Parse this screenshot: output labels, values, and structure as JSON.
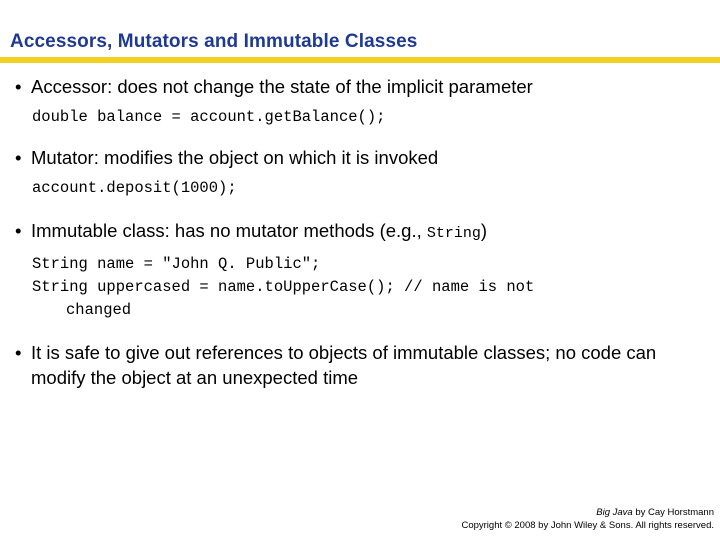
{
  "slide": {
    "title": "Accessors, Mutators and Immutable Classes",
    "accent_color": "#F2D022",
    "title_color": "#1F3A93",
    "bullet_marker": "•"
  },
  "content": {
    "bullet1": {
      "text": "Accessor: does not change the state of the implicit parameter",
      "code": "double balance = account.getBalance();"
    },
    "bullet2": {
      "text": "Mutator: modifies the object on which it is invoked",
      "code": "account.deposit(1000);"
    },
    "bullet3": {
      "text_before": "Immutable class: has no mutator methods (e.g., ",
      "inline_code": "String",
      "text_after": ")",
      "code_line1": "String name = \"John Q. Public\";",
      "code_line2": "String uppercased = name.toUpperCase(); // name is not",
      "code_line2_wrap": "changed"
    },
    "bullet4": {
      "text": "It is safe to give out references to objects of immutable classes; no code can modify the object at an unexpected time"
    }
  },
  "footer": {
    "book_title": "Big Java",
    "byline": " by Cay Horstmann",
    "copyright": "Copyright © 2008 by John Wiley & Sons.  All rights reserved."
  }
}
